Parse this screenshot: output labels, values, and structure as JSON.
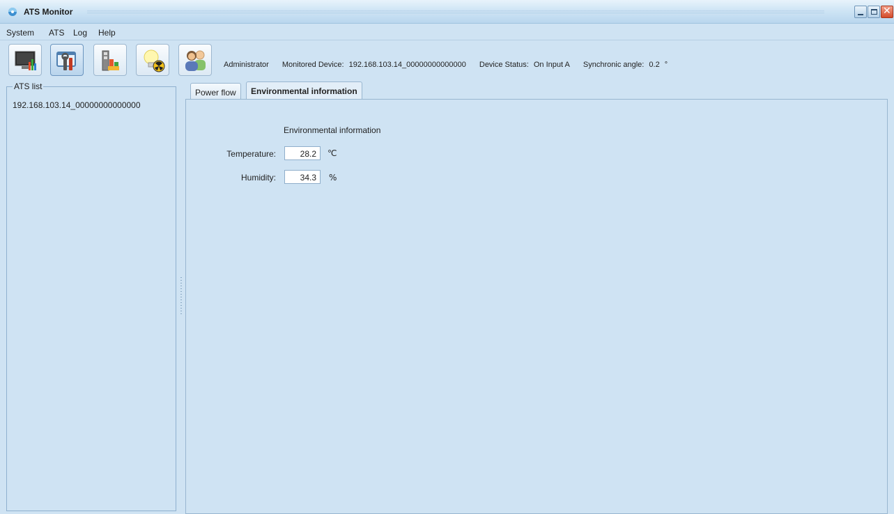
{
  "window": {
    "title": "ATS Monitor"
  },
  "menu": {
    "items": [
      "System",
      "ATS",
      "Log",
      "Help"
    ]
  },
  "toolbar": {
    "buttons": [
      {
        "icon": "monitor-chart-icon"
      },
      {
        "icon": "settings-tools-icon"
      },
      {
        "icon": "statistics-icon"
      },
      {
        "icon": "alarm-bulb-icon"
      },
      {
        "icon": "users-icon"
      }
    ]
  },
  "status": {
    "user": "Administrator",
    "monitored_device_label": "Monitored Device:",
    "monitored_device_value": "192.168.103.14_00000000000000",
    "device_status_label": "Device Status:",
    "device_status_value": "On Input A",
    "sync_angle_label": "Synchronic angle:",
    "sync_angle_value": "0.2",
    "sync_angle_unit": "°"
  },
  "ats_list": {
    "legend": "ATS list",
    "items": [
      "192.168.103.14_00000000000000"
    ]
  },
  "tabs": [
    {
      "label": "Power flow",
      "active": false
    },
    {
      "label": "Environmental information",
      "active": true
    }
  ],
  "environment": {
    "header": "Environmental information",
    "temperature": {
      "label": "Temperature:",
      "value": "28.2",
      "unit": "℃"
    },
    "humidity": {
      "label": "Humidity:",
      "value": "34.3",
      "unit": "%"
    }
  }
}
